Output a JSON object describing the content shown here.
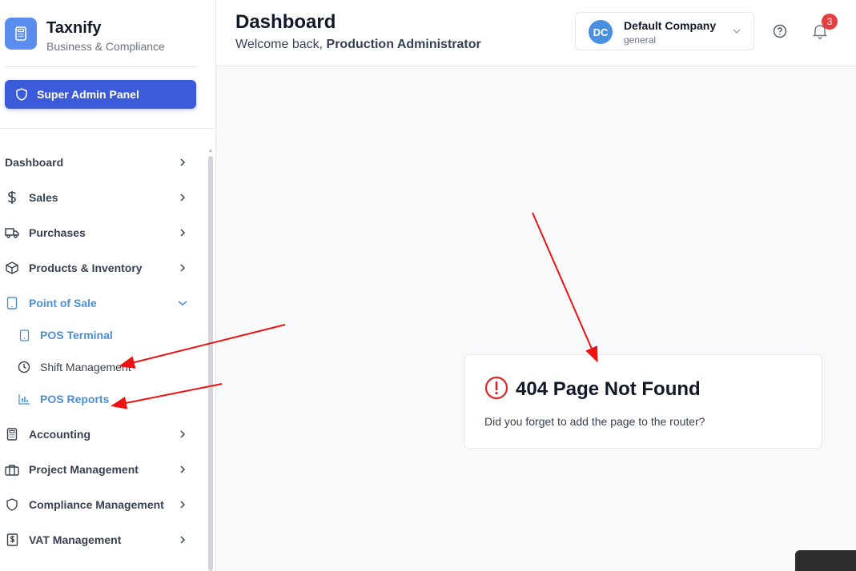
{
  "brand": {
    "name": "Taxnify",
    "subtitle": "Business & Compliance",
    "accent": "#5b8def"
  },
  "admin_button": {
    "label": "Super Admin Panel",
    "icon": "shield-icon",
    "color": "#3b5bdb"
  },
  "nav": {
    "items": [
      {
        "label": "Dashboard",
        "icon": ""
      },
      {
        "label": "Sales",
        "icon": "dollar-icon"
      },
      {
        "label": "Purchases",
        "icon": "truck-icon"
      },
      {
        "label": "Products & Inventory",
        "icon": "box-icon"
      },
      {
        "label": "Point of Sale",
        "icon": "tablet-icon",
        "expanded": true
      },
      {
        "label": "Accounting",
        "icon": "calculator-icon"
      },
      {
        "label": "Project Management",
        "icon": "briefcase-icon"
      },
      {
        "label": "Compliance Management",
        "icon": "shield-icon"
      },
      {
        "label": "VAT Management",
        "icon": "receipt-icon"
      }
    ],
    "pos_sub": [
      {
        "label": "POS Terminal",
        "icon": "tablet-icon"
      },
      {
        "label": "Shift Management",
        "icon": "clock-icon"
      },
      {
        "label": "POS Reports",
        "icon": "bar-chart-icon"
      }
    ],
    "active_color": "#4a90d9"
  },
  "header": {
    "title": "Dashboard",
    "welcome_prefix": "Welcome back, ",
    "user": "Production Administrator",
    "company": {
      "initials": "DC",
      "name": "Default Company",
      "sub": "general"
    },
    "notifications": "3"
  },
  "error_card": {
    "title": "404 Page Not Found",
    "message": "Did you forget to add the page to the router?",
    "icon": "alert-circle-icon",
    "icon_color": "#dc2626"
  }
}
